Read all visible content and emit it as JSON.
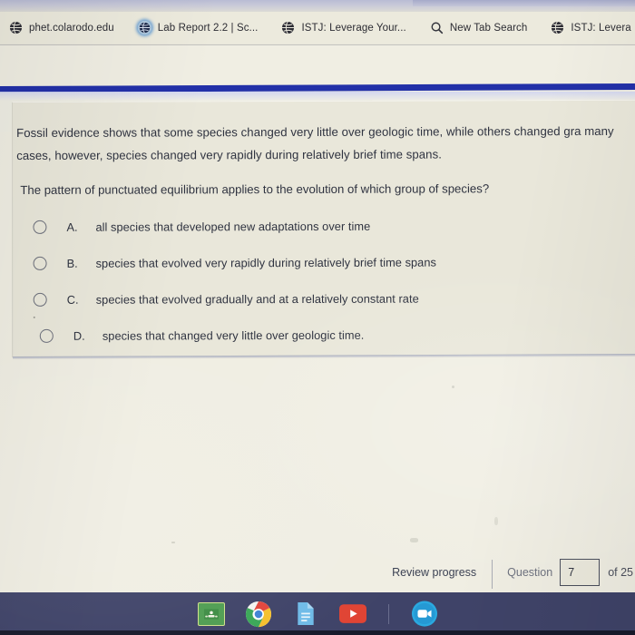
{
  "browser": {
    "bookmarks": [
      {
        "label": "phet.colarodo.edu",
        "icon": "globe-icon",
        "highlighted": false
      },
      {
        "label": "Lab Report 2.2 | Sc...",
        "icon": "globe-icon",
        "highlighted": true
      },
      {
        "label": "ISTJ: Leverage Your...",
        "icon": "globe-icon",
        "highlighted": false
      },
      {
        "label": "New Tab Search",
        "icon": "search-icon",
        "highlighted": false
      },
      {
        "label": "ISTJ: Levera",
        "icon": "globe-icon",
        "highlighted": false
      }
    ]
  },
  "question": {
    "stem": "Fossil evidence shows that some species changed very little over geologic time, while others changed gra many cases, however, species changed very rapidly during relatively brief time spans.",
    "prompt": "The pattern of punctuated equilibrium applies to the evolution of which group of species?",
    "options": [
      {
        "letter": "A.",
        "text": "all species that developed new adaptations over time",
        "selected": false
      },
      {
        "letter": "B.",
        "text": "species that evolved very rapidly during relatively brief time spans",
        "selected": false
      },
      {
        "letter": "C.",
        "text": "species that evolved gradually and at a relatively constant rate",
        "selected": false
      },
      {
        "letter": "D.",
        "text": "species that changed very little over geologic time.",
        "selected": false
      }
    ]
  },
  "footer": {
    "review_progress": "Review progress",
    "question_label": "Question",
    "question_number": "7",
    "of_total": "of 25"
  },
  "taskbar": {
    "items": [
      {
        "name": "google-classroom-icon"
      },
      {
        "name": "chrome-icon"
      },
      {
        "name": "google-docs-icon"
      },
      {
        "name": "youtube-icon"
      },
      {
        "name": "zoom-icon"
      }
    ]
  },
  "colors": {
    "page_background": "#e9e7db",
    "accent_band": "#2230a8",
    "taskbar": "#3f4368",
    "text": "#2f3340"
  }
}
